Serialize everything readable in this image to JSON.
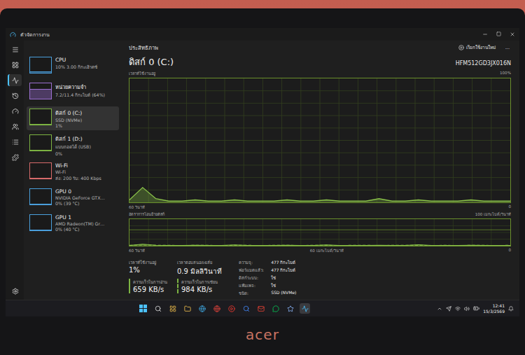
{
  "window": {
    "title": "ตัวจัดการงาน"
  },
  "nav": [
    {
      "selected": false
    },
    {
      "selected": false
    },
    {
      "selected": true
    },
    {
      "selected": false
    },
    {
      "selected": false
    },
    {
      "selected": false
    },
    {
      "selected": false
    },
    {
      "selected": false
    },
    {
      "selected": false
    }
  ],
  "page": {
    "title": "ประสิทธิภาพ",
    "action": "เรียกใช้งานใหม่",
    "more": "..."
  },
  "sidebar": {
    "items": [
      {
        "name": "CPU",
        "lines": [
          "10% 3.00 กิกะเฮิรตซ์"
        ],
        "selected": false,
        "level": 0.1,
        "color": "#4a9fdc"
      },
      {
        "name": "หน่วยความจำ",
        "lines": [
          "7.2/11.4 กิกะไบต์ (64%)"
        ],
        "selected": false,
        "level": 0.64,
        "color": "#9b6fd1"
      },
      {
        "name": "ดิสก์ 0 (C:)",
        "lines": [
          "SSD (NVMe)",
          "1%"
        ],
        "selected": true,
        "level": 0.01,
        "color": "#7cb342"
      },
      {
        "name": "ดิสก์ 1 (D:)",
        "lines": [
          "แบบถอดได้ (USB)",
          "0%"
        ],
        "selected": false,
        "level": 0.0,
        "color": "#7cb342"
      },
      {
        "name": "Wi-Fi",
        "lines": [
          "Wi-Fi",
          "ส่ง: 200 รับ: 400 Kbps"
        ],
        "selected": false,
        "level": 0.05,
        "color": "#d76a6a"
      },
      {
        "name": "GPU 0",
        "lines": [
          "NVIDIA GeForce GTX…",
          "0% (39 °C)"
        ],
        "selected": false,
        "level": 0.0,
        "color": "#4a9fdc"
      },
      {
        "name": "GPU 1",
        "lines": [
          "AMD Radeon(TM) Gr…",
          "0% (40 °C)"
        ],
        "selected": false,
        "level": 0.0,
        "color": "#4a9fdc"
      }
    ]
  },
  "disk": {
    "title": "ดิสก์ 0 (C:)",
    "model": "HFM512GD3JX016N",
    "active_chart": {
      "label": "เวลาที่ใช้งานอยู่",
      "max": "100%",
      "time": "60 วินาที",
      "min": "0",
      "values": [
        2,
        12,
        3,
        1,
        1,
        2,
        1,
        1,
        2,
        1,
        1,
        1,
        2,
        1,
        1,
        2,
        1,
        1,
        1,
        3,
        1,
        1,
        2,
        1,
        1,
        1,
        2,
        1,
        1,
        1
      ]
    },
    "transfer_chart": {
      "label": "อัตราการโอนย้ายดิสก์",
      "max": "100 เมกะไบต์/วินาที",
      "mid": "60 เมกะไบต์/วินาที",
      "time": "60 วินาที",
      "min": "0",
      "read": [
        1,
        6,
        2,
        1,
        1,
        2,
        1,
        1,
        3,
        1,
        1,
        1,
        2,
        1,
        1,
        3,
        1,
        1,
        1,
        2,
        1,
        1,
        4,
        1,
        1,
        1,
        2,
        1,
        1,
        1
      ],
      "write": [
        2,
        3,
        2,
        2,
        1,
        2,
        2,
        1,
        2,
        2,
        1,
        2,
        2,
        1,
        2,
        2,
        1,
        2,
        2,
        1,
        2,
        2,
        2,
        1,
        2,
        1,
        2,
        2,
        1,
        2
      ]
    }
  },
  "stats": [
    {
      "label": "เวลาที่ใช้งานอยู่",
      "value": "1%",
      "kind": "plain"
    },
    {
      "label": "เวลาตอบสนองเฉลี่ย",
      "value": "0.9 มิลลิวินาที",
      "kind": "plain"
    },
    {
      "label": "ความเร็วในการอ่าน",
      "value": "659 KB/s",
      "kind": "read"
    },
    {
      "label": "ความเร็วในการเขียน",
      "value": "984 KB/s",
      "kind": "write"
    }
  ],
  "properties": [
    {
      "label": "ความจุ:",
      "value": "477 กิกะไบต์"
    },
    {
      "label": "ฟอร์แมตแล้ว:",
      "value": "477 กิกะไบต์"
    },
    {
      "label": "ดิสก์ระบบ:",
      "value": "ใช่"
    },
    {
      "label": "แฟ้มเพจ:",
      "value": "ใช่"
    },
    {
      "label": "ชนิด:",
      "value": "SSD (NVMe)"
    }
  ],
  "taskbar": {
    "time": "12:41",
    "date": "15/3/2569"
  },
  "bezel": {
    "logo": "acer"
  }
}
